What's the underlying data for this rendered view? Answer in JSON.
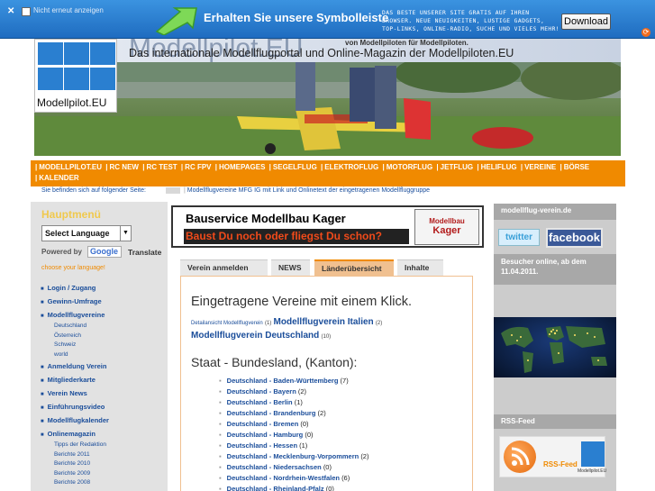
{
  "toolbar": {
    "close_label": "✕",
    "noshow_label": "Nicht erneut anzeigen",
    "title": "Erhalten Sie unsere Symbolleiste",
    "desc": "DAS BESTE UNSERER SITE GRATIS AUF IHREN BROWSER. NEUE NEUIGKEITEN, LUSTIGE GADGETS, TOP-LINKS, ONLINE-RADIO, SUCHE UND VIELES MEHR!",
    "download_label": "Download"
  },
  "header": {
    "site_name": "Modellpilot.EU",
    "tagline": "von Modellpiloten für Modellpiloten.",
    "subtitle": "Das internationale Modellflugportal und Online-Magazin der Modellpiloten.EU",
    "logo_text": "Modellpilot.EU"
  },
  "nav": {
    "items": [
      "MODELLPILOT.EU",
      "RC NEW",
      "RC TEST",
      "RC FPV",
      "HOMEPAGES",
      "SEGELFLUG",
      "ELEKTROFLUG",
      "MOTORFLUG",
      "JETFLUG",
      "HELIFLUG",
      "VEREINE",
      "BÖRSE",
      "KALENDER"
    ]
  },
  "breadcrumb": {
    "label": "Sie befinden sich auf folgender Seite:",
    "current": "Modellflugvereine MFG IG mit Link und Onlinetext der eingetragenen Modellfluggruppe"
  },
  "left": {
    "heading": "Hauptmenü",
    "language_select": "Select Language",
    "powered_by": "Powered by",
    "google": "Google",
    "translate": "Translate",
    "choose_language": "choose your language!",
    "menu": [
      {
        "label": "Login / Zugang",
        "type": "main"
      },
      {
        "label": "Gewinn-Umfrage",
        "type": "main"
      },
      {
        "label": "Modellflugvereine",
        "type": "main"
      },
      {
        "label": "Deutschland",
        "type": "sub"
      },
      {
        "label": "Österreich",
        "type": "sub"
      },
      {
        "label": "Schweiz",
        "type": "sub"
      },
      {
        "label": "world",
        "type": "sub"
      },
      {
        "label": "Anmeldung Verein",
        "type": "main"
      },
      {
        "label": "Mitgliederkarte",
        "type": "main"
      },
      {
        "label": "Verein News",
        "type": "main"
      },
      {
        "label": "Einführungsvideo",
        "type": "main"
      },
      {
        "label": "Modellflugkalender",
        "type": "main"
      },
      {
        "label": "Onlinemagazin",
        "type": "main"
      },
      {
        "label": "Tipps der Redaktion",
        "type": "sub"
      },
      {
        "label": "Berichte 2011",
        "type": "sub"
      },
      {
        "label": "Berichte 2010",
        "type": "sub"
      },
      {
        "label": "Berichte 2009",
        "type": "sub"
      },
      {
        "label": "Berichte 2008",
        "type": "sub"
      }
    ]
  },
  "ad": {
    "line1": "Bauservice Modellbau Kager",
    "line2": "Baust Du noch oder fliegst Du schon?",
    "logo_line1": "Modellbau",
    "logo_line2": "Kager"
  },
  "tabs": [
    {
      "label": "Verein anmelden"
    },
    {
      "label": "NEWS"
    },
    {
      "label": "Länderübersicht"
    },
    {
      "label": "Inhalte"
    }
  ],
  "content": {
    "intro": "Eingetragene Vereine mit einem Klick.",
    "links": {
      "detail_label": "Detailansicht Modellflugverein",
      "detail_count": "(1)",
      "italy_label": "Modellflugverein Italien",
      "italy_count": "(2)",
      "germany_label": "Modellflugverein Deutschland",
      "germany_count": "(10)"
    },
    "staat_heading": "Staat - Bundesland, (Kanton):",
    "regions": [
      {
        "name": "Deutschland - Baden-Württemberg",
        "count": "(7)"
      },
      {
        "name": "Deutschland - Bayern",
        "count": "(2)"
      },
      {
        "name": "Deutschland - Berlin",
        "count": "(1)"
      },
      {
        "name": "Deutschland - Brandenburg",
        "count": "(2)"
      },
      {
        "name": "Deutschland - Bremen",
        "count": "(0)"
      },
      {
        "name": "Deutschland - Hamburg",
        "count": "(0)"
      },
      {
        "name": "Deutschland - Hessen",
        "count": "(1)"
      },
      {
        "name": "Deutschland - Mecklenburg-Vorpommern",
        "count": "(2)"
      },
      {
        "name": "Deutschland - Niedersachsen",
        "count": "(0)"
      },
      {
        "name": "Deutschland - Nordrhein-Westfalen",
        "count": "(6)"
      },
      {
        "name": "Deutschland - Rheinland-Pfalz",
        "count": "(0)"
      }
    ]
  },
  "right": {
    "heading1": "modellflug-verein.de",
    "twitter": "twitter",
    "facebook": "facebook",
    "visitors_label": "Besucher online, ab dem 11.04.2011.",
    "rss_heading": "RSS-Feed",
    "rss_label": "RSS-Feed",
    "rss_logo_text": "Modellpilot.EU"
  },
  "colors": {
    "accent": "#f08a00",
    "toolbar": "#2a7fd0",
    "link": "#1a4d9a"
  }
}
